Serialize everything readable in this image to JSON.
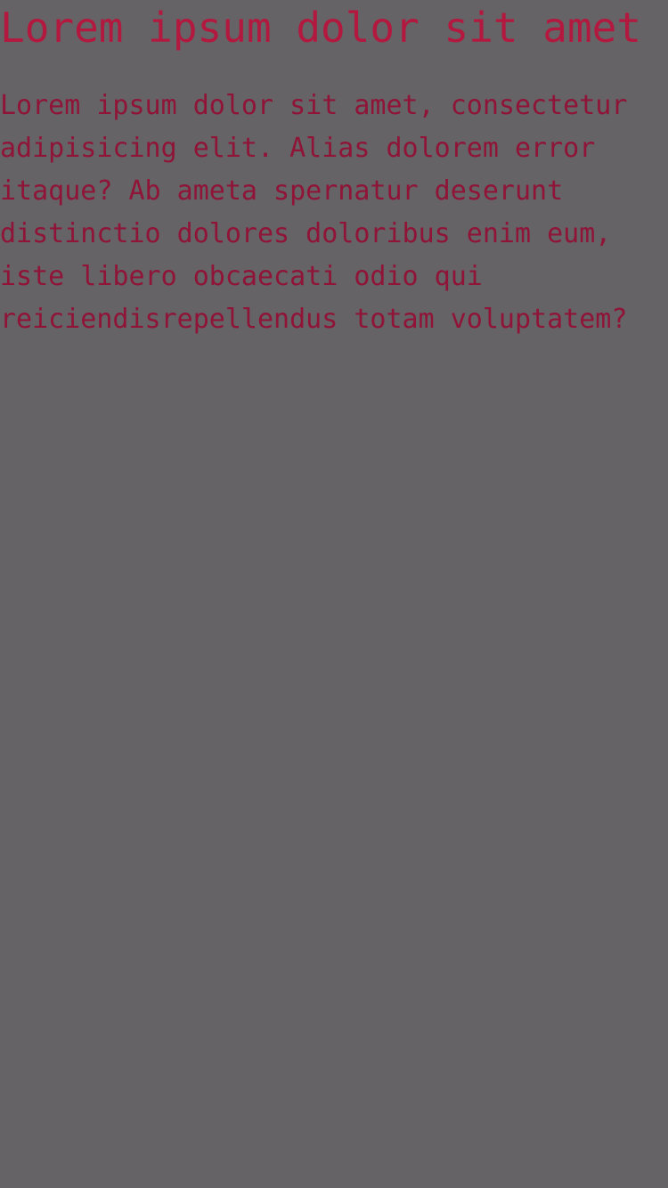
{
  "heading": "Lorem ipsum dolor sit amet",
  "paragraph": "Lorem ipsum dolor sit amet, consectetur adipisicing elit. Alias dolorem error itaque? Ab ameta spernatur deserunt distinctio dolores doloribus enim eum, iste libero obcaecati odio qui reiciendisrepellendus totam voluptatem?",
  "colors": {
    "background": "#656366",
    "heading": "#b3183f",
    "paragraph": "#8f1438"
  }
}
